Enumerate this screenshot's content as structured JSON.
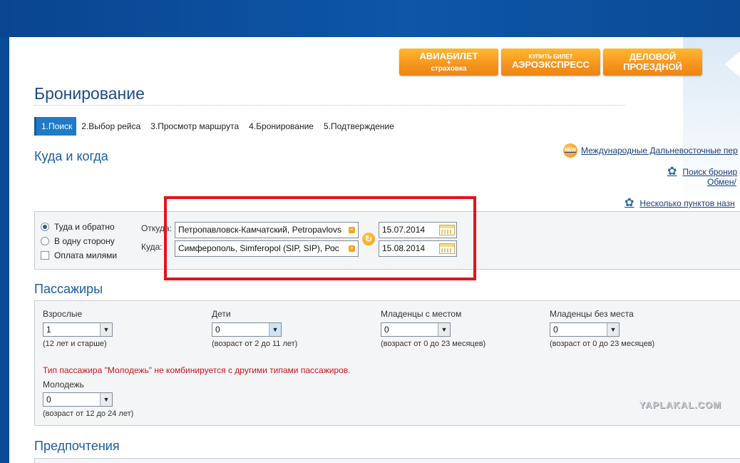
{
  "promos": {
    "avia_line1": "АВИАБИЛЕТ",
    "avia_line2": "+",
    "avia_line3": "страховка",
    "aero_line1": "купить билет",
    "aero_line2": "АЭРОЭКСПРЕСС",
    "biz_line1": "ДЕЛОВОЙ",
    "biz_line2": "ПРОЕЗДНОЙ"
  },
  "page_title": "Бронирование",
  "steps": [
    "1.Поиск",
    "2.Выбор рейса",
    "3.Просмотр маршрута",
    "4.Бронирование",
    "5.Подтверждение"
  ],
  "section_where": "Куда и когда",
  "links": {
    "new_badge": "NEW",
    "far_east": "Международные Дальневосточные пер",
    "search_booking": "Поиск бронир",
    "exchange": "Обмен/",
    "multi_point": "Несколько пунктов назн"
  },
  "trip_type": {
    "round_trip": "Туда и обратно",
    "one_way": "В одну сторону",
    "miles": "Оплата милями"
  },
  "route": {
    "from_label": "Откуда:",
    "to_label": "Куда:",
    "from_value": "Петропавловск-Камчатский, Petropavlovs",
    "to_value": "Симферополь, Simferopol (SIP, SIP), Рос",
    "date_out": "15.07.2014",
    "date_back": "15.08.2014"
  },
  "section_passengers": "Пассажиры",
  "passengers": {
    "adults_label": "Взрослые",
    "adults_value": "1",
    "adults_hint": "(12 лет и старше)",
    "children_label": "Дети",
    "children_value": "0",
    "children_hint": "(возраст от 2 до 11 лет)",
    "infants_seat_label": "Младенцы с местом",
    "infants_seat_value": "0",
    "infants_seat_hint": "(возраст от 0 до 23 месяцев)",
    "infants_noseat_label": "Младенцы без места",
    "infants_noseat_value": "0",
    "infants_noseat_hint": "(возраст от 0 до 23 месяцев)",
    "youth_warning": "Тип пассажира \"Молодежь\" не комбинируется с другими типами пассажиров.",
    "youth_label": "Молодежь",
    "youth_value": "0",
    "youth_hint": "(возраст от 12 до 24 лет)"
  },
  "section_prefs": "Предпочтения",
  "watermark": "YAPLAKAL.COM",
  "colors": {
    "accent_orange": "#f7941d",
    "title_blue": "#1b4c86",
    "active_step": "#1f7bc8",
    "highlight_red": "#e1141c",
    "warning_red": "#c8141c"
  }
}
